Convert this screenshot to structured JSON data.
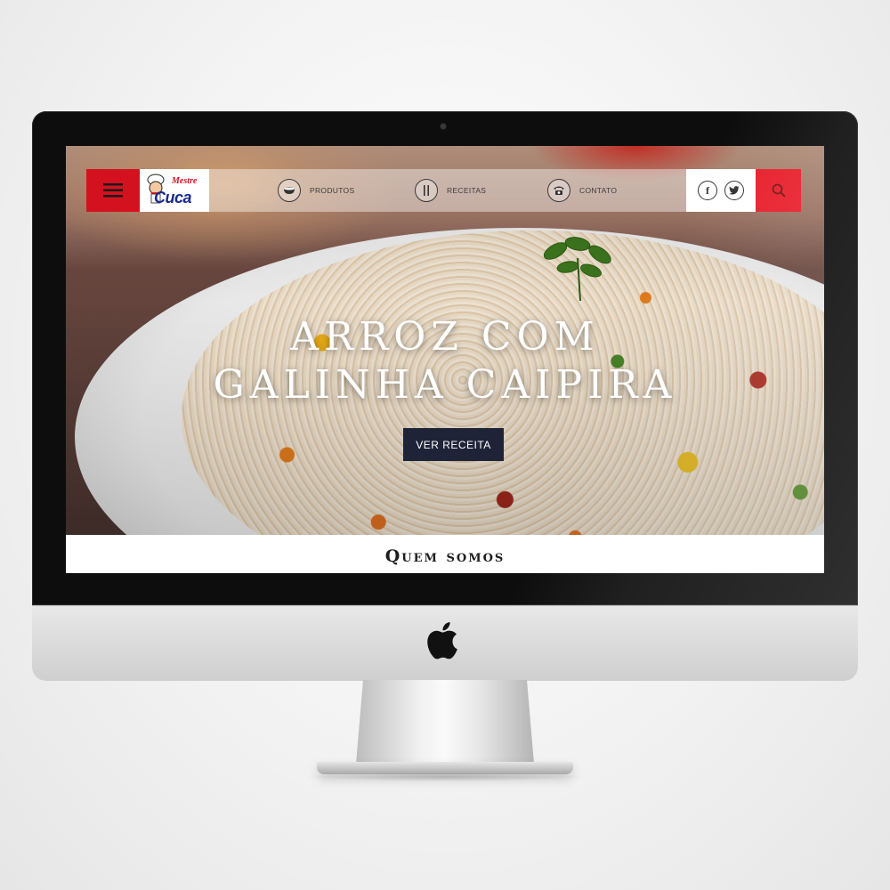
{
  "nav": {
    "logo_top": "Mestre",
    "logo_bottom": "Cuca",
    "items": [
      {
        "label": "PRODUTOS",
        "icon": "bowl-icon"
      },
      {
        "label": "RECEITAS",
        "icon": "cutlery-icon"
      },
      {
        "label": "CONTATO",
        "icon": "phone-icon"
      }
    ],
    "social": {
      "facebook": "f",
      "twitter": "t"
    }
  },
  "hero": {
    "title_line1": "ARROZ COM",
    "title_line2": "GALINHA CAIPIRA",
    "cta_label": "VER RECEITA"
  },
  "section": {
    "title": "Quem somos"
  },
  "colors": {
    "brand_red": "#d4121f",
    "search_red": "#e8202d",
    "cta_navy": "#1e2338"
  }
}
